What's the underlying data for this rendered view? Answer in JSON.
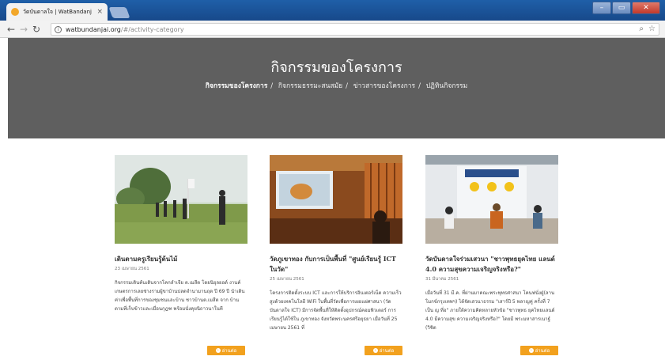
{
  "browser": {
    "tab_title": "วัดบันดาลใจ | WatBandanj",
    "tab_close": "×",
    "url_host": "watbundanjai.org",
    "url_path": "/#/activity-category",
    "window_buttons": [
      "–",
      "▭",
      "✕"
    ]
  },
  "hero": {
    "title": "กิจกรรมของโครงการ",
    "breadcrumb": [
      "กิจกรรมของโครงการ",
      "กิจกรรมธรรมะสนสมัย",
      "ข่าวสารของโครงการ",
      "ปฏิทินกิจกรรม"
    ],
    "breadcrumb_sep": "/"
  },
  "cards": [
    {
      "title": "เดินตามครูเรียนรู้ต้นไม้",
      "date": "23 เมษายน 2561",
      "body": "กิจกรรมเดินค้นเดินจากโคกลำเจีย ต.เมสีต โดยนิยุลยอด์ งานค์ เกษตรการเลยช่างรามผู้ขาบ้านปลดจำนามานฤต ปี 69 ปี นำเดิน ค่าเพื่อพื้นที่การของชุมชนและบ้าน ชาวบ้านต.เมสีต จาก บ้านตามที่เก็บข้าวและเมื่อนกุฎฑ พร้อมนั่งคุยนิถาวนาในที",
      "readmore": "อ่านต่อ"
    },
    {
      "title": "วัดภูเขาทอง กับการเป็นพื้นที่ \"ศูนย์เรียนรู้ ICT ในวัด\"",
      "date": "25 เมษายน 2561",
      "body": "โครงการติดตั้งระบบ ICT และการให้บริการอินเตอร์เน็ต ความเร็ว สูงด้วยเทคโนโลยี WiFi ในพื้นที่วัดเพื่อการเผยแผ่ศาสนา (วัดบันดาลใจ ICT) มีการจัดพื้นที่ให้ติดตั้งอุปกรณ์คอมพิวเตอร์ การเรียนรู้ได้ใช้ใน ภูเขาทอง จังหวัดพระนครศรีอยุธยา เมื่อวันที่ 25 เมษายน 2561 ที่",
      "readmore": "อ่านต่อ"
    },
    {
      "title": "วัดบันดาลใจร่วมเสวนา \"ชาวพุทธยุคไทย แลนด์ 4.0 ความสุขความเจริญจริงหรือ?\"",
      "date": "31 มีนาคม 2561",
      "body": "เมื่อวันที่ 31 มี.ค. ที่ผ่านมาคณะพระพุทธศาสนา โคนฟนั่งฝู่(ลาน โมกข์กรุงเทพฯ) ได้จัดเสวนาธรรม \"เสาร์ปี 5 พลาญคู่ ครั้งที่ 7 เป็น ญ ที่อ\" ภายใต้ความคิดหลายหัวข้อ \"ชาวพุทธ ยุคไทยแลนด์ 4.0 มีความสุข ความเจริญจริงหรือ?\" โดยมี พระมหาสารเนาฐ์ (วิชิต",
      "readmore": "อ่านต่อ"
    }
  ],
  "colors": {
    "hero_bg": "#5f5f5f",
    "accent": "#f2a11e"
  }
}
